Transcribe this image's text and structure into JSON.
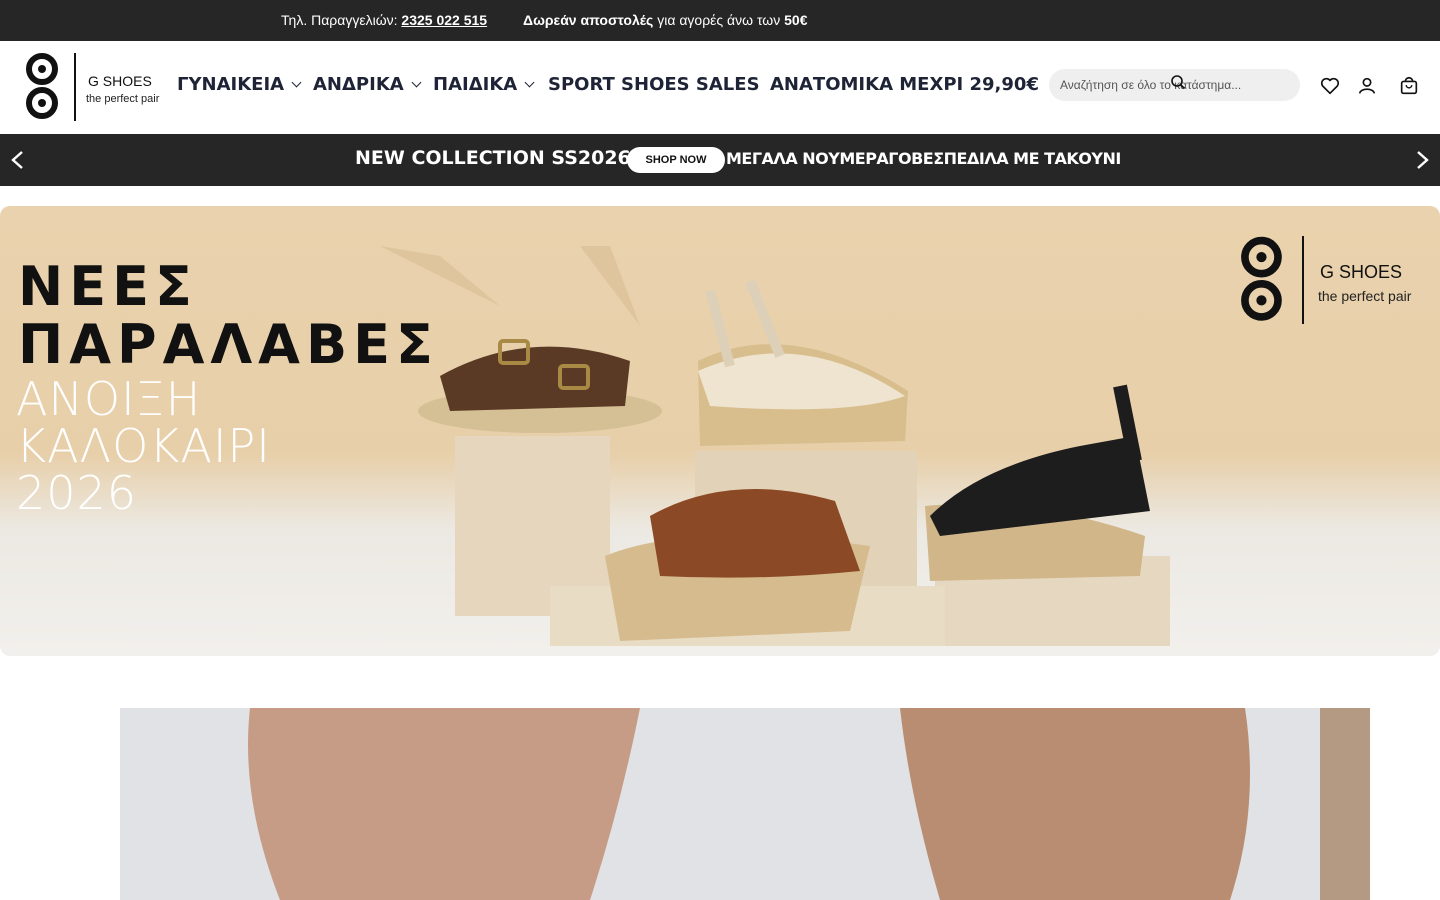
{
  "topbar": {
    "phone_label": "Τηλ. Παραγγελιών:",
    "phone_number": "2325 022 515",
    "shipping_bold": "Δωρεάν αποστολές",
    "shipping_text": "για αγορές άνω των",
    "shipping_amount": "50€"
  },
  "brand": {
    "name": "G SHOES",
    "tagline": "the perfect pair"
  },
  "nav": {
    "items": [
      {
        "label": "ΓΥΝΑΙΚΕΙΑ",
        "has_dropdown": true
      },
      {
        "label": "ΑΝΔΡΙΚΑ",
        "has_dropdown": true
      },
      {
        "label": "ΠΑΙΔΙΚΑ",
        "has_dropdown": true
      },
      {
        "label": "SPORT SHOES SALES",
        "has_dropdown": false
      },
      {
        "label": "ΑΝΑΤΟΜΙΚΑ ΜΕΧΡΙ 29,90€",
        "has_dropdown": false
      }
    ]
  },
  "search": {
    "placeholder": "Αναζήτηση σε όλο το κατάστημα..."
  },
  "header_icons": [
    "heart-icon",
    "user-icon",
    "bag-icon"
  ],
  "promo": {
    "title": "NEW COLLECTION SS2026",
    "button_label": "SHOP NOW",
    "secondary": "ΜΕΓΑΛΑ ΝΟΥΜΕΡΑΓΟΒΕΣΠΕΔΙΛΑ ΜΕ ΤΑΚΟΥΝΙ"
  },
  "hero": {
    "headline_line1": "ΝΕΕΣ",
    "headline_line2": "ΠΑΡΑΛΑΒΕΣ",
    "season_line1": "ΑΝΟΙΞΗ",
    "season_line2": "ΚΑΛΟΚΑΙΡΙ",
    "season_line3": "2026"
  },
  "colors": {
    "topbar_bg": "#262626",
    "nav_text": "#1e2436",
    "hero_bg": "#e9d2ad"
  }
}
